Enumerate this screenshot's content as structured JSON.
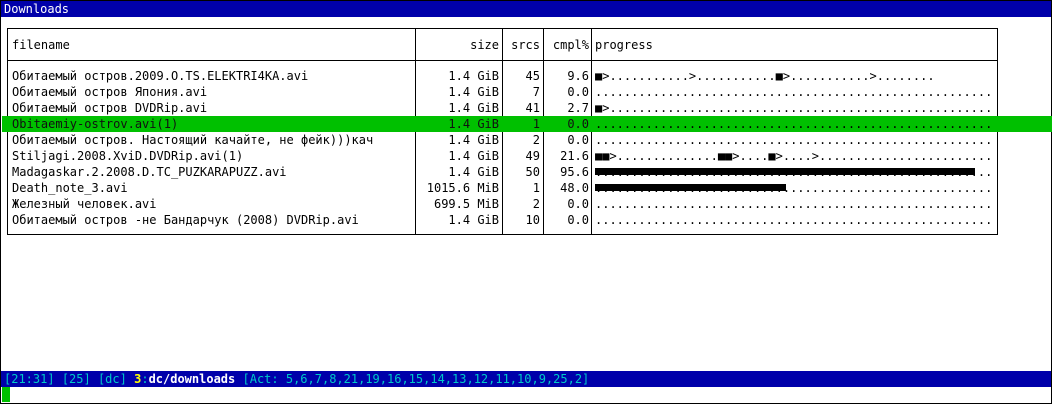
{
  "window": {
    "title": "Downloads"
  },
  "table": {
    "headers": {
      "filename": "filename",
      "size": "size",
      "srcs": "srcs",
      "cmpl": "cmpl%",
      "progress": "progress"
    },
    "rows": [
      {
        "filename": "Обитаемый остров.2009.O.TS.ELEKTRI4KA.avi",
        "size": "1.4 GiB",
        "srcs": "45",
        "cmpl": "9.6",
        "pct": 9.6,
        "progress_text": "■>...........>...........■>...........>........",
        "selected": false
      },
      {
        "filename": "Обитаемый остров Япония.avi",
        "size": "1.4 GiB",
        "srcs": "7",
        "cmpl": "0.0",
        "pct": 0.0,
        "progress_text": "..............................................................",
        "selected": false
      },
      {
        "filename": "Обитаемый остров DVDRip.avi",
        "size": "1.4 GiB",
        "srcs": "41",
        "cmpl": "2.7",
        "pct": 2.7,
        "progress_text": "■>............................................................",
        "selected": false
      },
      {
        "filename": "Obitaemiy-ostrov.avi(1)",
        "size": "1.4 GiB",
        "srcs": "1",
        "cmpl": "0.0",
        "pct": 0.0,
        "progress_text": "..............................................................",
        "selected": true
      },
      {
        "filename": "Обитаемый остров. Настоящий качайте, не фейк)))кач",
        "size": "1.4 GiB",
        "srcs": "2",
        "cmpl": "0.0",
        "pct": 0.0,
        "progress_text": "..............................................................",
        "selected": false
      },
      {
        "filename": "Stiljagi.2008.XviD.DVDRip.avi(1)",
        "size": "1.4 GiB",
        "srcs": "49",
        "cmpl": "21.6",
        "pct": 21.6,
        "progress_text": "■■>..............■■>....■>....>..............................",
        "selected": false
      },
      {
        "filename": "Madagaskar.2.2008.D.TC_PUZKARAPUZZ.avi",
        "size": "1.4 GiB",
        "srcs": "50",
        "cmpl": "95.6",
        "pct": 95.6,
        "progress_text": "..............................................................",
        "selected": false
      },
      {
        "filename": "Death_note_3.avi",
        "size": "1015.6 MiB",
        "srcs": "1",
        "cmpl": "48.0",
        "pct": 48.0,
        "progress_text": "..............................................................",
        "selected": false
      },
      {
        "filename": "Железный человек.avi",
        "size": "699.5 MiB",
        "srcs": "2",
        "cmpl": "0.0",
        "pct": 0.0,
        "progress_text": "..............................................................",
        "selected": false
      },
      {
        "filename": "Обитаемый остров -не Бандарчук (2008) DVDRip.avi",
        "size": "1.4 GiB",
        "srcs": "10",
        "cmpl": "0.0",
        "pct": 0.0,
        "progress_text": "..............................................................",
        "selected": false
      }
    ]
  },
  "statusbar": {
    "time": "[21:31]",
    "count": "[25]",
    "hub": "[dc]",
    "window_num": "3",
    "window_sep": ":",
    "window_name": "dc/downloads",
    "activity": "[Act: 5,6,7,8,21,19,16,15,14,13,12,11,10,9,25,2]"
  },
  "colors": {
    "title_bg": "#0000aa",
    "selected_row": "#00c000",
    "status_text": "#00c8c8",
    "status_highlight": "#ffff00"
  }
}
